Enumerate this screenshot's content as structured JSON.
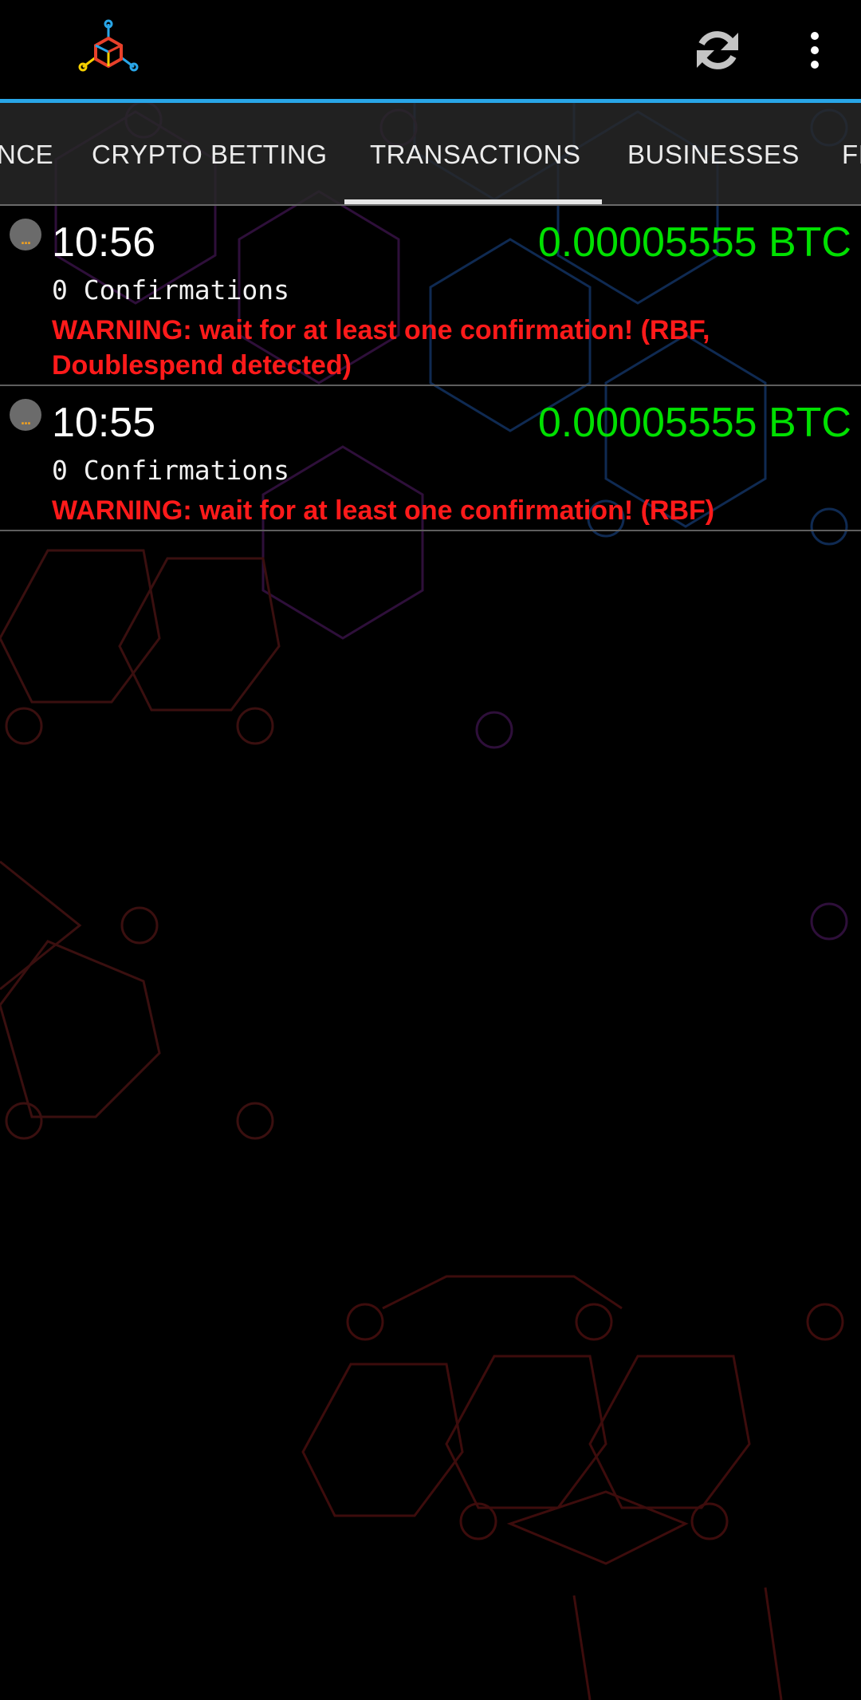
{
  "app": {
    "logo_icon": "mycelium-logo-icon",
    "refresh_icon": "refresh-icon",
    "overflow_icon": "more-vert-icon",
    "accent_color": "#29a6e8"
  },
  "tabs": [
    {
      "label": "NCE",
      "selected": false
    },
    {
      "label": "CRYPTO BETTING",
      "selected": false
    },
    {
      "label": "TRANSACTIONS",
      "selected": true
    },
    {
      "label": "BUSINESSES",
      "selected": false
    },
    {
      "label": "FI",
      "selected": false
    }
  ],
  "transactions": [
    {
      "time": "10:56",
      "amount": "0.00005555 BTC",
      "confirmations": "0 Confirmations",
      "warning_line1": "WARNING: wait for at least one confirmation! (RBF,",
      "warning_line2": "Doublespend detected)",
      "status_icon": "pending-icon",
      "status_glyph": "..."
    },
    {
      "time": "10:55",
      "amount": "0.00005555 BTC",
      "confirmations": "0 Confirmations",
      "warning_line1": "WARNING: wait for at least one confirmation! (RBF)",
      "warning_line2": "",
      "status_icon": "pending-icon",
      "status_glyph": "..."
    }
  ],
  "colors": {
    "amount": "#00e000",
    "warning": "#ff1a1a",
    "background": "#000000"
  }
}
